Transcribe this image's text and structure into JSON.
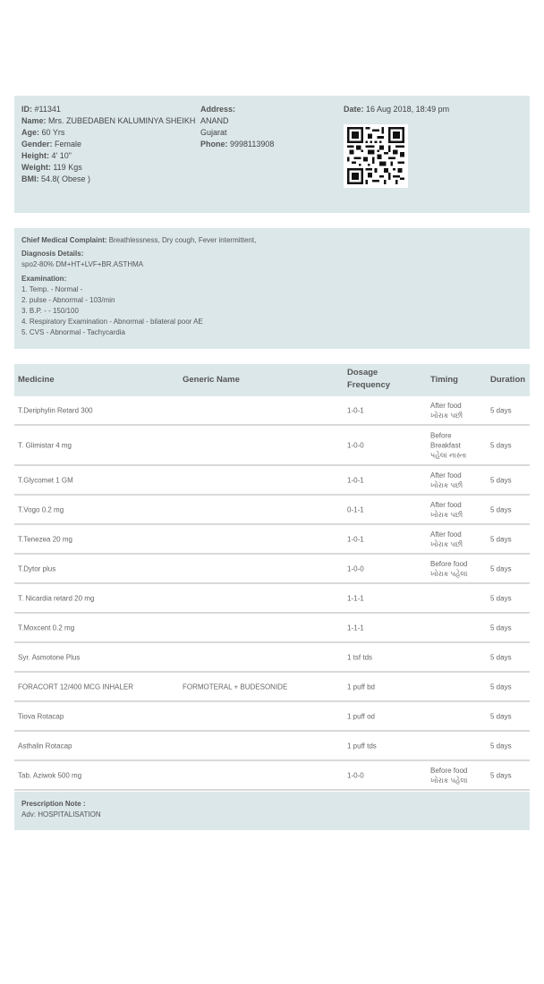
{
  "patient": {
    "id_label": "ID:",
    "id_value": "#11341",
    "name_label": "Name:",
    "name_value": "Mrs. ZUBEDABEN KALUMINYA SHEIKH",
    "age_label": "Age:",
    "age_value": "60 Yrs",
    "gender_label": "Gender:",
    "gender_value": "Female",
    "height_label": "Height:",
    "height_value": "4' 10\"",
    "weight_label": "Weight:",
    "weight_value": "119 Kgs",
    "bmi_label": "BMI:",
    "bmi_value": "54.8( Obese )",
    "address_label": "Address:",
    "address_line1": "ANAND",
    "address_line2": "Gujarat",
    "phone_label": "Phone:",
    "phone_value": "9998113908",
    "date_label": "Date:",
    "date_value": "16 Aug 2018, 18:49 pm"
  },
  "clinical": {
    "complaint_label": "Chief Medical Complaint:",
    "complaint_value": "Breathlessness, Dry cough, Fever intermittent,",
    "diagnosis_label": "Diagnosis Details:",
    "diagnosis_value": "spo2-80% DM+HT+LVF+BR.ASTHMA",
    "exam_label": "Examination:",
    "exam_items": [
      "1. Temp. - Normal -",
      "2. pulse - Abnormal - 103/min",
      "3. B.P. - - 150/100",
      "4. Respiratory Examination - Abnormal - bilateral poor AE",
      "5. CVS - Abnormal - Tachycardia"
    ]
  },
  "table": {
    "headers": {
      "medicine": "Medicine",
      "generic": "Generic Name",
      "dosage_line1": "Dosage",
      "dosage_line2": "Frequency",
      "timing": "Timing",
      "duration": "Duration"
    },
    "rows": [
      {
        "medicine": "T.Deriphylin Retard 300",
        "generic": "",
        "dosage": "1-0-1",
        "timing": [
          "After food",
          "ખોરાક પછી"
        ],
        "duration": "5 days"
      },
      {
        "medicine": "T. Glimistar 4 mg",
        "generic": "",
        "dosage": "1-0-0",
        "timing": [
          "Before",
          "Breakfast",
          "પહેલાં નાસ્તા"
        ],
        "duration": "5 days"
      },
      {
        "medicine": "T.Glycomet 1 GM",
        "generic": "",
        "dosage": "1-0-1",
        "timing": [
          "After food",
          "ખોરાક પછી"
        ],
        "duration": "5 days"
      },
      {
        "medicine": "T.Vogo 0.2 mg",
        "generic": "",
        "dosage": "0-1-1",
        "timing": [
          "After food",
          "ખોરાક પછી"
        ],
        "duration": "5 days"
      },
      {
        "medicine": "T.Tenezea 20 mg",
        "generic": "",
        "dosage": "1-0-1",
        "timing": [
          "After food",
          "ખોરાક પછી"
        ],
        "duration": "5 days"
      },
      {
        "medicine": "T.Dytor plus",
        "generic": "",
        "dosage": "1-0-0",
        "timing": [
          "Before food",
          "ખોરાક પહેલાં"
        ],
        "duration": "5 days"
      },
      {
        "medicine": "T. Nicardia retard 20 mg",
        "generic": "",
        "dosage": "1-1-1",
        "timing": [],
        "duration": "5 days"
      },
      {
        "medicine": "T.Moxcent 0.2 mg",
        "generic": "",
        "dosage": "1-1-1",
        "timing": [],
        "duration": "5 days"
      },
      {
        "medicine": "Syr. Asmotone Plus",
        "generic": "",
        "dosage": "1 tsf tds",
        "timing": [],
        "duration": "5 days"
      },
      {
        "medicine": "FORACORT 12/400 MCG INHALER",
        "generic": "FORMOTERAL + BUDESONIDE",
        "dosage": "1 puff bd",
        "timing": [],
        "duration": "5 days"
      },
      {
        "medicine": "Tiova Rotacap",
        "generic": "",
        "dosage": "1 puff od",
        "timing": [],
        "duration": "5 days"
      },
      {
        "medicine": "Asthalin Rotacap",
        "generic": "",
        "dosage": "1 puff tds",
        "timing": [],
        "duration": "5 days"
      },
      {
        "medicine": "Tab. Aziwok 500 mg",
        "generic": "",
        "dosage": "1-0-0",
        "timing": [
          "Before food",
          "ખોરાક પહેલાં"
        ],
        "duration": "5 days"
      }
    ]
  },
  "note": {
    "title": "Prescription Note :",
    "text": "Adv: HOSPITALISATION"
  }
}
